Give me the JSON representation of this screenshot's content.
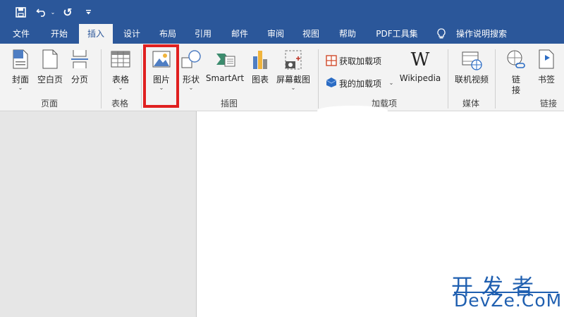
{
  "quick_access": {
    "redo_icon": "↺"
  },
  "tabs": [
    {
      "label": "文件"
    },
    {
      "label": "开始"
    },
    {
      "label": "插入"
    },
    {
      "label": "设计"
    },
    {
      "label": "布局"
    },
    {
      "label": "引用"
    },
    {
      "label": "邮件"
    },
    {
      "label": "审阅"
    },
    {
      "label": "视图"
    },
    {
      "label": "帮助"
    },
    {
      "label": "PDF工具集"
    },
    {
      "label": "操作说明搜索"
    }
  ],
  "ribbon": {
    "page": {
      "cover": "封面",
      "blank": "空白页",
      "break": "分页",
      "group": "页面"
    },
    "table": {
      "table": "表格",
      "group": "表格"
    },
    "illustrations": {
      "picture": "图片",
      "shapes": "形状",
      "smartart": "SmartArt",
      "chart": "图表",
      "screenshot": "屏幕截图",
      "group": "插图"
    },
    "addins": {
      "get": "获取加载项",
      "mine": "我的加载项",
      "wikipedia": "Wikipedia",
      "wikipedia_logo": "W",
      "group": "加载项"
    },
    "media": {
      "online_video": "联机视频",
      "group": "媒体"
    },
    "links": {
      "link_1": "链",
      "link_2": "接",
      "bookmark": "书签",
      "group": "链接"
    }
  },
  "watermark": {
    "line1": "开发者",
    "line2": "DevZe.CoM"
  },
  "colors": {
    "brand": "#2b579a",
    "ribbon_bg": "#f3f3f3",
    "highlight": "#e02020",
    "watermark": "#1f5fb0"
  }
}
